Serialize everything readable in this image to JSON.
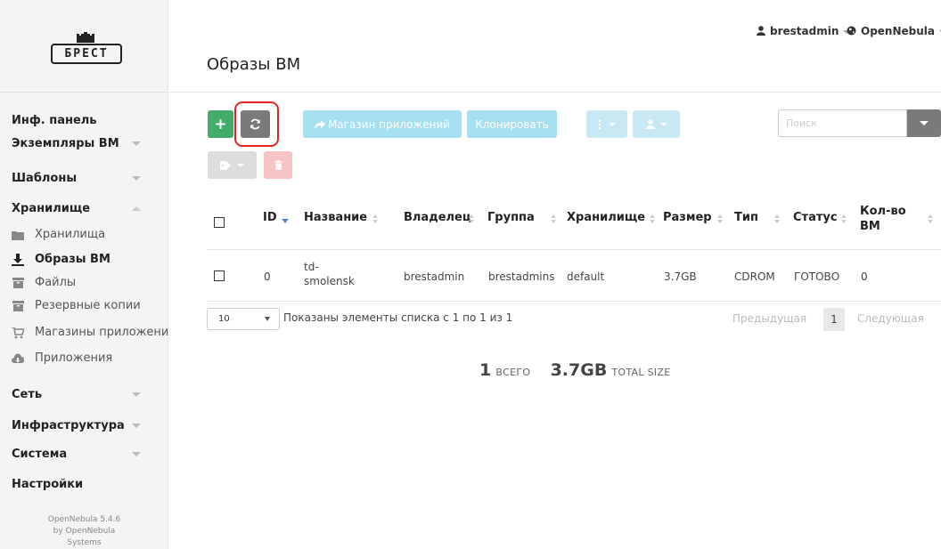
{
  "sidebar": {
    "logo_text": "БРЕСТ",
    "menu": {
      "dashboard": "Инф. панель",
      "vms": "Экземпляры ВМ",
      "templates": "Шаблоны",
      "storage": "Хранилище",
      "network": "Сеть",
      "infrastructure": "Инфраструктура",
      "system": "Система",
      "settings": "Настройки"
    },
    "storage_items": {
      "datastores": "Хранилища",
      "images": "Образы ВМ",
      "files": "Файлы",
      "backups": "Резервные копии",
      "marketplaces": "Магазины приложений",
      "apps": "Приложения"
    },
    "version_line1": "OpenNebula 5.4.6",
    "version_line2": "by OpenNebula",
    "version_line3": "Systems"
  },
  "header": {
    "user": "brestadmin",
    "zone": "OpenNebula",
    "title": "Образы ВМ"
  },
  "toolbar": {
    "add_label": "+",
    "marketplace_label": "Магазин приложений",
    "clone_label": "Клонировать",
    "search_placeholder": "Поиск"
  },
  "table": {
    "headers": {
      "id": "ID",
      "name": "Название",
      "owner": "Владелец",
      "group": "Группа",
      "datastore": "Хранилище",
      "size": "Размер",
      "type": "Тип",
      "status": "Статус",
      "vms_line1": "Кол-во",
      "vms_line2": "ВМ"
    },
    "rows": [
      {
        "id": "0",
        "name_line1": "td-",
        "name_line2": "smolensk",
        "owner": "brestadmin",
        "group": "brestadmins",
        "datastore": "default",
        "size": "3.7GB",
        "type": "CDROM",
        "status": "ГОТОВО",
        "vms": "0"
      }
    ]
  },
  "footer": {
    "page_size": "10",
    "page_info": "Показаны элементы списка с 1 по 1 из 1",
    "prev_label": "Предыдущая",
    "current_page": "1",
    "next_label": "Следующая"
  },
  "summary": {
    "total_count": "1",
    "total_label": "ВСЕГО",
    "total_size": "3.7GB",
    "size_label": "TOTAL SIZE"
  },
  "colors": {
    "add": "#43ac6a",
    "refresh": "#7a7a7a",
    "highlight": "#e52320",
    "secondary_disabled": "#a6dff0",
    "delete_disabled": "#f6c4c4"
  },
  "icons": {
    "refresh": "refresh-icon",
    "marketplace": "share-arrow-icon",
    "user": "user-icon",
    "globe": "globe-icon",
    "tag": "tag-icon",
    "trash": "trash-icon"
  }
}
